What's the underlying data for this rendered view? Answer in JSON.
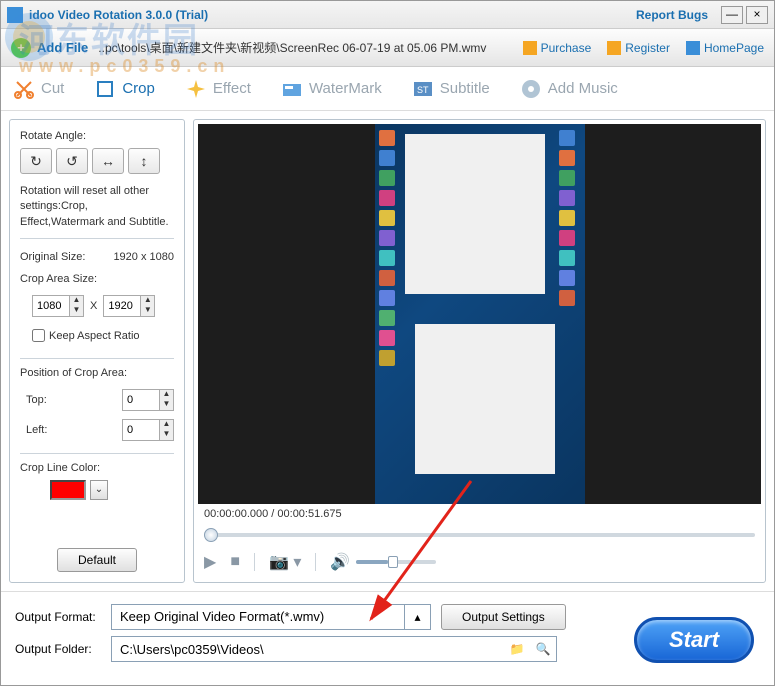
{
  "window": {
    "title": "idoo Video Rotation 3.0.0 (Trial)",
    "report": "Report Bugs"
  },
  "addbar": {
    "add_label": "Add File",
    "path": "..pc\\tools\\桌面\\新建文件夹\\新视频\\ScreenRec 06-07-19 at 05.06 PM.wmv",
    "purchase": "Purchase",
    "register": "Register",
    "homepage": "HomePage"
  },
  "toolbar": {
    "cut": "Cut",
    "crop": "Crop",
    "effect": "Effect",
    "watermark": "WaterMark",
    "subtitle": "Subtitle",
    "addmusic": "Add Music"
  },
  "side": {
    "rotate_label": "Rotate Angle:",
    "reset_note": "Rotation will reset all other settings:Crop, Effect,Watermark and Subtitle.",
    "orig_size_label": "Original Size:",
    "orig_size": "1920 x 1080",
    "crop_size_label": "Crop Area Size:",
    "crop_w": "1080",
    "crop_x": "X",
    "crop_h": "1920",
    "keep_ratio": "Keep Aspect Ratio",
    "pos_label": "Position of Crop Area:",
    "top_label": "Top:",
    "top_val": "0",
    "left_label": "Left:",
    "left_val": "0",
    "line_color_label": "Crop Line Color:",
    "line_color": "#ff0000",
    "default_btn": "Default"
  },
  "player": {
    "time": "00:00:00.000 / 00:00:51.675"
  },
  "output": {
    "format_label": "Output Format:",
    "format_value": "Keep Original Video Format(*.wmv)",
    "settings_btn": "Output Settings",
    "folder_label": "Output Folder:",
    "folder_value": "C:\\Users\\pc0359\\Videos\\",
    "start": "Start"
  },
  "watermark": {
    "main": "河东软件园",
    "sub": "www.pc0359.cn"
  }
}
